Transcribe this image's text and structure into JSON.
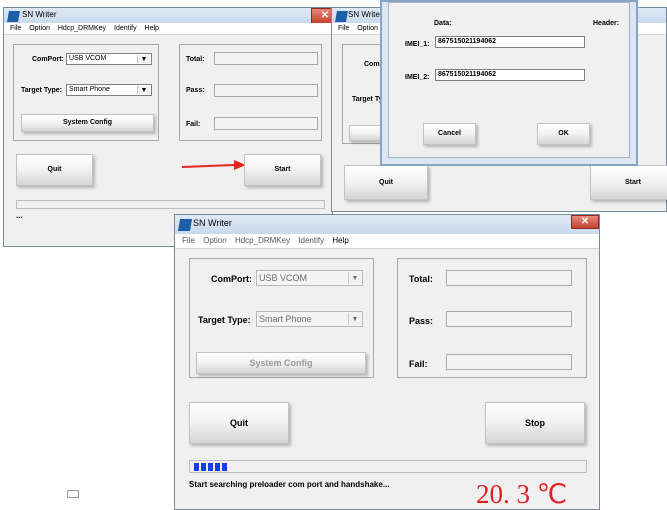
{
  "win1": {
    "title": "SN Writer",
    "menu": [
      "File",
      "Option",
      "Hdcp_DRMKey",
      "Identify",
      "Help"
    ],
    "comport_label": "ComPort:",
    "comport_value": "USB VCOM",
    "target_label": "Target Type:",
    "target_value": "Smart Phone",
    "sysconfig_label": "System Config",
    "total_label": "Total:",
    "pass_label": "Pass:",
    "fail_label": "Fail:",
    "quit_label": "Quit",
    "start_label": "Start",
    "status_text": "..."
  },
  "win2": {
    "title": "SN Writer",
    "menu": [
      "File",
      "Option"
    ],
    "comport_partial": "ComP",
    "target_partial": "Target Ty",
    "quit_label": "Quit",
    "start_label": "Start"
  },
  "dialog": {
    "data_label": "Data:",
    "header_label": "Header:",
    "imei1_label": "IMEI_1:",
    "imei1_value": "867515021194062",
    "imei2_label": "IMEI_2:",
    "imei2_value": "867515021194062",
    "cancel_label": "Cancel",
    "ok_label": "OK"
  },
  "win3": {
    "title": "SN Writer",
    "menu": [
      "File",
      "Option",
      "Hdcp_DRMKey",
      "Identify",
      "Help"
    ],
    "comport_label": "ComPort:",
    "comport_value": "USB VCOM",
    "target_label": "Target Type:",
    "target_value": "Smart Phone",
    "sysconfig_label": "System Config",
    "total_label": "Total:",
    "pass_label": "Pass:",
    "fail_label": "Fail:",
    "quit_label": "Quit",
    "stop_label": "Stop",
    "status_text": "Start searching preloader com port and handshake...",
    "progress_blocks": 5
  },
  "temperature": "20. 3 ℃",
  "colors": {
    "arrow": "#e8251c",
    "temperature": "#e02020",
    "progress": "#1a3ee6"
  }
}
